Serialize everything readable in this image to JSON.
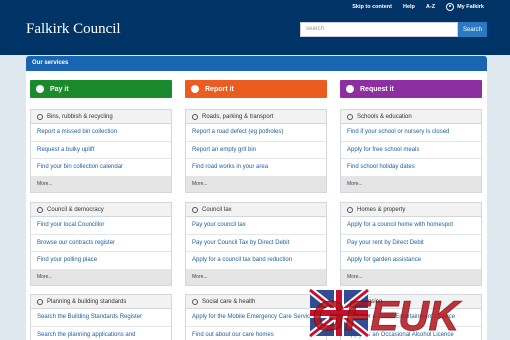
{
  "utility": {
    "skip": "Skip to content",
    "help": "Help",
    "az": "A-Z",
    "my": "My Falkirk"
  },
  "logo": "Falkirk Council",
  "search": {
    "placeholder": "search",
    "button": "Search"
  },
  "panel_title": "Our services",
  "actions": [
    {
      "label": "Pay it",
      "icon": "info-circle-icon",
      "color": "#1b8a2c"
    },
    {
      "label": "Report it",
      "icon": "flag-icon",
      "color": "#ea5c1f"
    },
    {
      "label": "Request it",
      "icon": "pencil-icon",
      "color": "#8d2fa0"
    }
  ],
  "cards": [
    {
      "title": "Bins, rubbish & recycling",
      "icon": "recycle-icon",
      "links": [
        "Report a missed bin collection",
        "Request a bulky uplift",
        "Find your bin collection calendar"
      ],
      "more": "More..."
    },
    {
      "title": "Roads, parking & transport",
      "icon": "car-icon",
      "links": [
        "Report a road defect (eg potholes)",
        "Report an empty grit bin",
        "Find road works in your area"
      ],
      "more": "More..."
    },
    {
      "title": "Schools & education",
      "icon": "graduation-icon",
      "links": [
        "Find if your school or nursery is closed",
        "Apply for free school meals",
        "Find school holiday dates"
      ],
      "more": "More..."
    },
    {
      "title": "Council & democracy",
      "icon": "bulb-icon",
      "links": [
        "Find your local Councillor",
        "Browse our contracts register",
        "Find your polling place"
      ],
      "more": "More..."
    },
    {
      "title": "Council tax",
      "icon": "coin-icon",
      "links": [
        "Pay your council tax",
        "Pay your Council Tax by Direct Debit",
        "Apply for a council tax band reduction"
      ],
      "more": "More..."
    },
    {
      "title": "Homes & property",
      "icon": "home-icon",
      "links": [
        "Apply for a council home with homespot",
        "Pay your rent by Direct Debit",
        "Apply for garden assistance"
      ],
      "more": "More..."
    },
    {
      "title": "Planning & building standards",
      "icon": "building-icon",
      "links": [
        "Search the Building Standards Register",
        "Search the planning applications and"
      ],
      "more": ""
    },
    {
      "title": "Social care & health",
      "icon": "heart-icon",
      "links": [
        "Apply for the Mobile Emergency Care Service",
        "Find out about our care homes"
      ],
      "more": ""
    },
    {
      "title": "Licensing",
      "icon": "license-icon",
      "links": [
        "Apply for a Public Entertainment Licence",
        "Apply for an Occasional Alcohol Licence"
      ],
      "more": ""
    }
  ],
  "watermark": "GFEUK"
}
